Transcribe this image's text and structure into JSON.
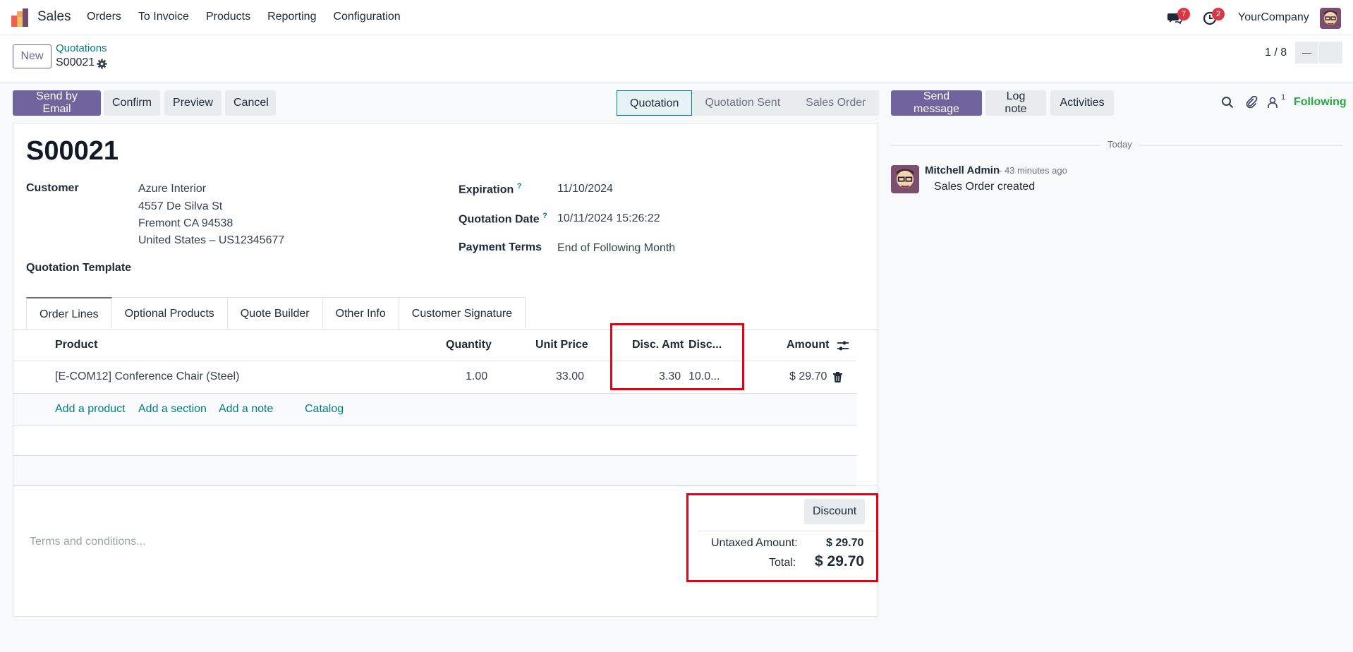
{
  "navbar": {
    "app_name": "Sales",
    "menu": [
      "Orders",
      "To Invoice",
      "Products",
      "Reporting",
      "Configuration"
    ],
    "messages_badge": "7",
    "activities_badge": "2",
    "company": "YourCompany"
  },
  "control": {
    "new_label": "New",
    "breadcrumb_parent": "Quotations",
    "breadcrumb_current": "S00021",
    "pager": "1 / 8"
  },
  "actions": {
    "send_email": "Send by Email",
    "confirm": "Confirm",
    "preview": "Preview",
    "cancel": "Cancel"
  },
  "stages": [
    "Quotation",
    "Quotation Sent",
    "Sales Order"
  ],
  "chatter": {
    "send_message": "Send message",
    "log_note": "Log note",
    "activities": "Activities",
    "followers_count": "1",
    "following": "Following",
    "today": "Today",
    "author": "Mitchell Admin",
    "time": "- 43 minutes ago",
    "body": "Sales Order created"
  },
  "form": {
    "title": "S00021",
    "customer_label": "Customer",
    "customer_lines": [
      "Azure Interior",
      "4557 De Silva St",
      "Fremont CA 94538",
      "United States – US12345677"
    ],
    "template_label": "Quotation Template",
    "expiration_label": "Expiration",
    "expiration": "11/10/2024",
    "quotation_date_label": "Quotation Date",
    "quotation_date": "10/11/2024 15:26:22",
    "payment_terms_label": "Payment Terms",
    "payment_terms": "End of Following Month",
    "help_mark": "?"
  },
  "tabs": [
    "Order Lines",
    "Optional Products",
    "Quote Builder",
    "Other Info",
    "Customer Signature"
  ],
  "table": {
    "headers": {
      "product": "Product",
      "quantity": "Quantity",
      "unit_price": "Unit Price",
      "disc_amt": "Disc. Amt",
      "disc": "Disc...",
      "amount": "Amount"
    },
    "rows": [
      {
        "product": "[E-COM12] Conference Chair (Steel)",
        "quantity": "1.00",
        "unit_price": "33.00",
        "disc_amt": "3.30",
        "disc": "10.0...",
        "amount": "$ 29.70"
      }
    ],
    "add_links": [
      "Add a product",
      "Add a section",
      "Add a note",
      "Catalog"
    ]
  },
  "footer": {
    "terms_placeholder": "Terms and conditions...",
    "discount_button": "Discount",
    "untaxed_label": "Untaxed Amount:",
    "untaxed_value": "$ 29.70",
    "total_label": "Total:",
    "total_value": "$ 29.70"
  },
  "colors": {
    "brand": "#71639e",
    "link": "#017e84",
    "highlight": "#e50012",
    "badge": "#dc3545",
    "following": "#28a745"
  }
}
